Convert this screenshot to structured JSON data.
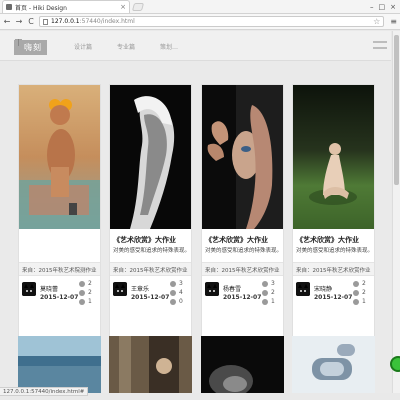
{
  "browser": {
    "tab_title": "首页 - Hiki Design",
    "tab_close": "×",
    "url_host": "127.0.0.1",
    "url_path": ":57440/index.html",
    "back": "←",
    "forward": "→",
    "reload": "C",
    "star": "☆",
    "menu": "≡",
    "win_min": "–",
    "win_max": "□",
    "win_close": "×"
  },
  "site": {
    "logo": "嗨刻",
    "logo_pin": "⊤",
    "nav": [
      "设计篇",
      "专业篇",
      "策划…"
    ]
  },
  "cards": [
    {
      "title": "",
      "desc": "",
      "meta": "来自：2015年秋艺术院测作业",
      "author": "莫晓蕾",
      "date": "2015-12-07",
      "stats": [
        "2",
        "2",
        "1"
      ]
    },
    {
      "title": "《艺术欣赏》大作业",
      "desc": "对美的感受和追求的特殊表现。…",
      "meta": "来自：2015年秋艺术欣赏作业",
      "author": "王章乐",
      "date": "2015-12-07",
      "stats": [
        "3",
        "4",
        "0"
      ]
    },
    {
      "title": "《艺术欣赏》大作业",
      "desc": "对美的感受和追求的特殊表现。…",
      "meta": "来自：2015年秋艺术欣赏作业",
      "author": "杨春雪",
      "date": "2015-12-07",
      "stats": [
        "3",
        "2",
        "1"
      ]
    },
    {
      "title": "《艺术欣赏》大作业",
      "desc": "对美的感受和追求的特殊表现。…",
      "meta": "来自：2015年秋艺术欣赏作业",
      "author": "宋晓静",
      "date": "2015-12-07",
      "stats": [
        "2",
        "2",
        "1"
      ]
    }
  ],
  "status_url": "127.0.0.1:57440/index.html#"
}
